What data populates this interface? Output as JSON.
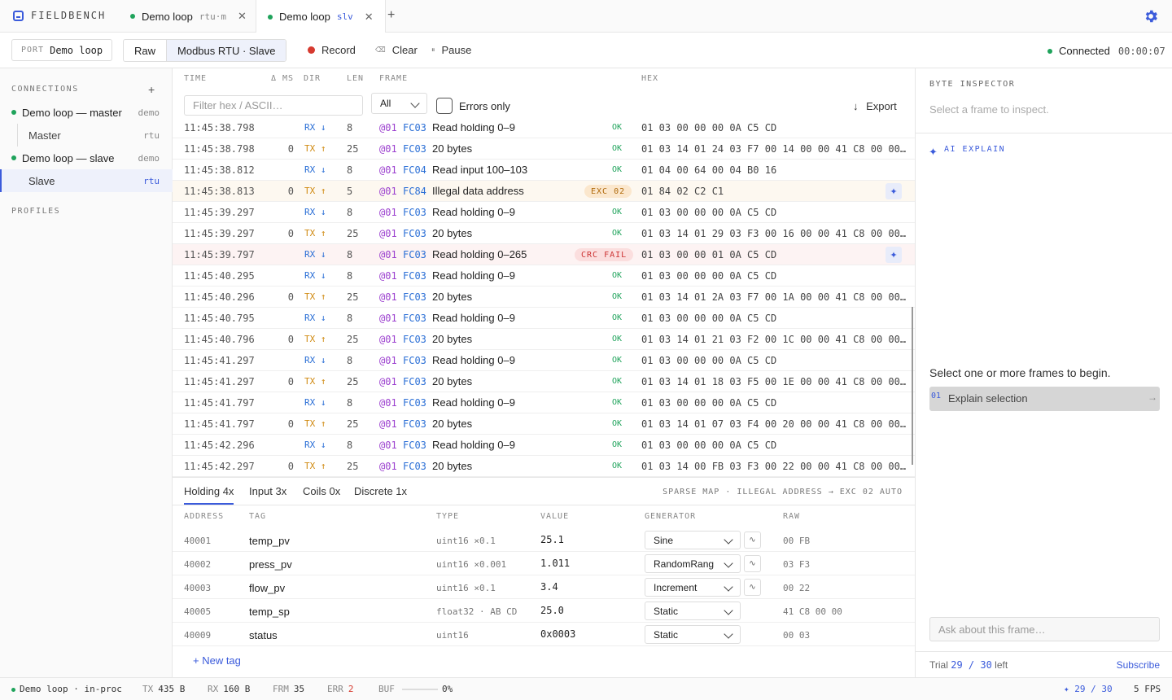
{
  "brand": "FIELDBENCH",
  "tabs": [
    {
      "label": "Demo loop",
      "sub": "rtu·m"
    },
    {
      "label": "Demo loop",
      "sub": "slv"
    }
  ],
  "toolbar": {
    "port_key": "PORT",
    "port_value": "Demo loop",
    "mode_raw": "Raw",
    "mode_modbus": "Modbus RTU · Slave",
    "record": "Record",
    "clear": "Clear",
    "pause": "Pause",
    "status": "Connected",
    "elapsed": "00:00:07"
  },
  "sidebar": {
    "connections_title": "CONNECTIONS",
    "profiles_title": "PROFILES",
    "items": [
      {
        "label": "Demo loop — master",
        "tag": "demo"
      },
      {
        "label": "Master",
        "tag": "rtu"
      },
      {
        "label": "Demo loop — slave",
        "tag": "demo"
      },
      {
        "label": "Slave",
        "tag": "rtu"
      }
    ]
  },
  "frames": {
    "headers": {
      "time": "TIME",
      "delta": "Δ MS",
      "dir": "DIR",
      "len": "LEN",
      "frame": "FRAME",
      "hex": "HEX"
    },
    "filter_placeholder": "Filter hex / ASCII…",
    "filter_select": "All",
    "errors_only": "Errors only",
    "export": "Export",
    "rows": [
      {
        "time": "11:45:38.798",
        "delta": "",
        "dir": "RX ↓",
        "len": "8",
        "addr": "@01",
        "fc": "FC03",
        "desc": "Read holding 0–9",
        "status": "OK",
        "hex": "01 03 00 00 00 0A C5 CD"
      },
      {
        "time": "11:45:38.798",
        "delta": "0",
        "dir": "TX ↑",
        "len": "25",
        "addr": "@01",
        "fc": "FC03",
        "desc": "20 bytes",
        "status": "OK",
        "hex": "01 03 14 01 24 03 F7 00 14 00 00 41 C8 00 00…"
      },
      {
        "time": "11:45:38.812",
        "delta": "",
        "dir": "RX ↓",
        "len": "8",
        "addr": "@01",
        "fc": "FC04",
        "desc": "Read input 100–103",
        "status": "OK",
        "hex": "01 04 00 64 00 04 B0 16"
      },
      {
        "time": "11:45:38.813",
        "delta": "0",
        "dir": "TX ↑",
        "len": "5",
        "addr": "@01",
        "fc": "FC84",
        "desc": "Illegal data address",
        "status": "EXC 02",
        "hex": "01 84 02 C2 C1"
      },
      {
        "time": "11:45:39.297",
        "delta": "",
        "dir": "RX ↓",
        "len": "8",
        "addr": "@01",
        "fc": "FC03",
        "desc": "Read holding 0–9",
        "status": "OK",
        "hex": "01 03 00 00 00 0A C5 CD"
      },
      {
        "time": "11:45:39.297",
        "delta": "0",
        "dir": "TX ↑",
        "len": "25",
        "addr": "@01",
        "fc": "FC03",
        "desc": "20 bytes",
        "status": "OK",
        "hex": "01 03 14 01 29 03 F3 00 16 00 00 41 C8 00 00…"
      },
      {
        "time": "11:45:39.797",
        "delta": "",
        "dir": "RX ↓",
        "len": "8",
        "addr": "@01",
        "fc": "FC03",
        "desc": "Read holding 0–265",
        "status": "CRC FAIL",
        "hex": "01 03 00 00 01 0A C5 CD"
      },
      {
        "time": "11:45:40.295",
        "delta": "",
        "dir": "RX ↓",
        "len": "8",
        "addr": "@01",
        "fc": "FC03",
        "desc": "Read holding 0–9",
        "status": "OK",
        "hex": "01 03 00 00 00 0A C5 CD"
      },
      {
        "time": "11:45:40.296",
        "delta": "0",
        "dir": "TX ↑",
        "len": "25",
        "addr": "@01",
        "fc": "FC03",
        "desc": "20 bytes",
        "status": "OK",
        "hex": "01 03 14 01 2A 03 F7 00 1A 00 00 41 C8 00 00…"
      },
      {
        "time": "11:45:40.795",
        "delta": "",
        "dir": "RX ↓",
        "len": "8",
        "addr": "@01",
        "fc": "FC03",
        "desc": "Read holding 0–9",
        "status": "OK",
        "hex": "01 03 00 00 00 0A C5 CD"
      },
      {
        "time": "11:45:40.796",
        "delta": "0",
        "dir": "TX ↑",
        "len": "25",
        "addr": "@01",
        "fc": "FC03",
        "desc": "20 bytes",
        "status": "OK",
        "hex": "01 03 14 01 21 03 F2 00 1C 00 00 41 C8 00 00…"
      },
      {
        "time": "11:45:41.297",
        "delta": "",
        "dir": "RX ↓",
        "len": "8",
        "addr": "@01",
        "fc": "FC03",
        "desc": "Read holding 0–9",
        "status": "OK",
        "hex": "01 03 00 00 00 0A C5 CD"
      },
      {
        "time": "11:45:41.297",
        "delta": "0",
        "dir": "TX ↑",
        "len": "25",
        "addr": "@01",
        "fc": "FC03",
        "desc": "20 bytes",
        "status": "OK",
        "hex": "01 03 14 01 18 03 F5 00 1E 00 00 41 C8 00 00…"
      },
      {
        "time": "11:45:41.797",
        "delta": "",
        "dir": "RX ↓",
        "len": "8",
        "addr": "@01",
        "fc": "FC03",
        "desc": "Read holding 0–9",
        "status": "OK",
        "hex": "01 03 00 00 00 0A C5 CD"
      },
      {
        "time": "11:45:41.797",
        "delta": "0",
        "dir": "TX ↑",
        "len": "25",
        "addr": "@01",
        "fc": "FC03",
        "desc": "20 bytes",
        "status": "OK",
        "hex": "01 03 14 01 07 03 F4 00 20 00 00 41 C8 00 00…"
      },
      {
        "time": "11:45:42.296",
        "delta": "",
        "dir": "RX ↓",
        "len": "8",
        "addr": "@01",
        "fc": "FC03",
        "desc": "Read holding 0–9",
        "status": "OK",
        "hex": "01 03 00 00 00 0A C5 CD"
      },
      {
        "time": "11:45:42.297",
        "delta": "0",
        "dir": "TX ↑",
        "len": "25",
        "addr": "@01",
        "fc": "FC03",
        "desc": "20 bytes",
        "status": "OK",
        "hex": "01 03 14 00 FB 03 F3 00 22 00 00 41 C8 00 00…"
      }
    ]
  },
  "registers": {
    "tabs": [
      "Holding 4x",
      "Input 3x",
      "Coils 0x",
      "Discrete 1x"
    ],
    "note": "SPARSE MAP · ILLEGAL ADDRESS → EXC 02 AUTO",
    "headers": {
      "address": "ADDRESS",
      "tag": "TAG",
      "type": "TYPE",
      "value": "VALUE",
      "generator": "GENERATOR",
      "raw": "RAW"
    },
    "rows": [
      {
        "address": "40001",
        "tag": "temp_pv",
        "type": "uint16 ×0.1",
        "value": "25.1",
        "generator": "Sine",
        "wave": true,
        "raw": "00 FB"
      },
      {
        "address": "40002",
        "tag": "press_pv",
        "type": "uint16 ×0.001",
        "value": "1.011",
        "generator": "RandomRang",
        "wave": true,
        "raw": "03 F3"
      },
      {
        "address": "40003",
        "tag": "flow_pv",
        "type": "uint16 ×0.1",
        "value": "3.4",
        "generator": "Increment",
        "wave": true,
        "raw": "00 22"
      },
      {
        "address": "40005",
        "tag": "temp_sp",
        "type": "float32 · AB CD",
        "value": "25.0",
        "generator": "Static",
        "wave": false,
        "raw": "41 C8 00 00"
      },
      {
        "address": "40009",
        "tag": "status",
        "type": "uint16",
        "value": "0x0003",
        "generator": "Static",
        "wave": false,
        "raw": "00 03"
      }
    ],
    "new_tag": "+ New tag"
  },
  "inspector": {
    "title": "BYTE INSPECTOR",
    "hint": "Select a frame to inspect.",
    "ai_title": "AI EXPLAIN",
    "begin": "Select one or more frames to begin.",
    "explain_badge": "01",
    "explain_label": "Explain selection",
    "ask_placeholder": "Ask about this frame…",
    "trial_prefix": "Trial",
    "trial_count": "29 / 30",
    "trial_suffix": "left",
    "subscribe": "Subscribe"
  },
  "statusbar": {
    "conn": "Demo loop · in-proc",
    "tx_k": "TX",
    "tx_v": "435 B",
    "rx_k": "RX",
    "rx_v": "160 B",
    "frm_k": "FRM",
    "frm_v": "35",
    "err_k": "ERR",
    "err_v": "2",
    "buf_k": "BUF",
    "buf_v": "0%",
    "buf_fraction": 0,
    "ai": "✦ 29 / 30",
    "fps": "5 FPS"
  },
  "colors": {
    "accent": "#3b5bdb",
    "ok": "#1fa35b",
    "rx": "#2b6fd6",
    "tx": "#d08a12",
    "error": "#d63a2f"
  }
}
